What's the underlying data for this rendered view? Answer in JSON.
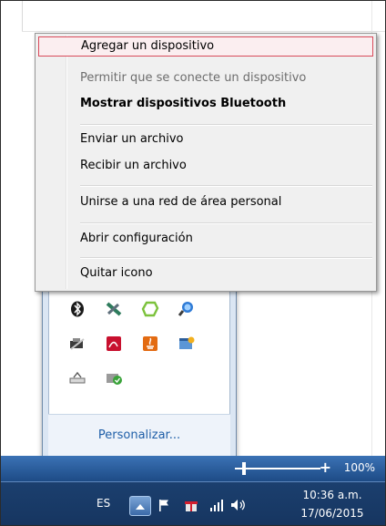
{
  "context_menu": {
    "items": [
      {
        "label": "Agregar un dispositivo",
        "state": "hover"
      },
      {
        "label": "Permitir que se conecte un dispositivo",
        "state": "disabled"
      },
      {
        "label": "Mostrar dispositivos Bluetooth",
        "state": "bold"
      },
      {
        "label": "Enviar un archivo",
        "state": "normal"
      },
      {
        "label": "Recibir un archivo",
        "state": "normal"
      },
      {
        "label": "Unirse a una red de área personal",
        "state": "normal"
      },
      {
        "label": "Abrir configuración",
        "state": "normal"
      },
      {
        "label": "Quitar icono",
        "state": "normal"
      }
    ]
  },
  "tray_flyout": {
    "icons": [
      "bluetooth-icon",
      "network-tool-icon",
      "green-app-icon",
      "search-people-icon",
      "usb-drive-icon",
      "pdf-reader-icon",
      "java-icon",
      "app-window-icon",
      "safely-remove-icon",
      "update-check-icon"
    ],
    "customize_label": "Personalizar..."
  },
  "taskbar": {
    "zoom_percent": "100%",
    "zoom_plus": "+",
    "language": "ES",
    "time": "10:36 a.m.",
    "date": "17/06/2015"
  },
  "colors": {
    "hover_border": "#d94b5b",
    "link": "#1f5fa8",
    "taskbar": "#1b3f6e"
  }
}
